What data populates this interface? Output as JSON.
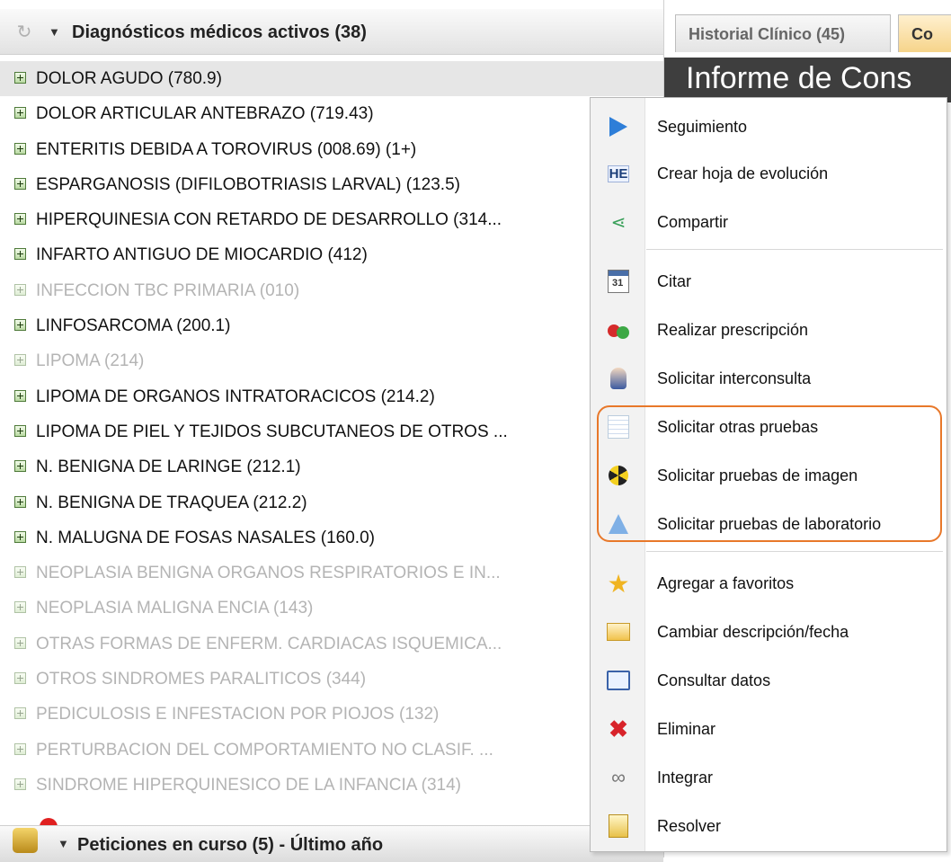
{
  "left_panel": {
    "header_title": "Diagnósticos médicos activos  (38)",
    "diagnoses": [
      {
        "label": "DOLOR AGUDO (780.9)",
        "active": true,
        "selected": true
      },
      {
        "label": "DOLOR ARTICULAR ANTEBRAZO (719.43)",
        "active": true
      },
      {
        "label": "ENTERITIS DEBIDA A TOROVIRUS (008.69) (1+)",
        "active": true
      },
      {
        "label": "ESPARGANOSIS (DIFILOBOTRIASIS LARVAL) (123.5)",
        "active": true
      },
      {
        "label": "HIPERQUINESIA CON RETARDO DE DESARROLLO (314...",
        "active": true
      },
      {
        "label": "INFARTO ANTIGUO DE MIOCARDIO (412)",
        "active": true
      },
      {
        "label": "INFECCION TBC PRIMARIA (010)",
        "active": false
      },
      {
        "label": "LINFOSARCOMA (200.1)",
        "active": true
      },
      {
        "label": "LIPOMA (214)",
        "active": false
      },
      {
        "label": "LIPOMA DE ORGANOS INTRATORACICOS (214.2)",
        "active": true
      },
      {
        "label": "LIPOMA DE PIEL Y TEJIDOS SUBCUTANEOS DE OTROS ...",
        "active": true
      },
      {
        "label": "N. BENIGNA DE LARINGE (212.1)",
        "active": true
      },
      {
        "label": "N. BENIGNA DE TRAQUEA (212.2)",
        "active": true
      },
      {
        "label": "N. MALUGNA DE FOSAS NASALES (160.0)",
        "active": true
      },
      {
        "label": "NEOPLASIA BENIGNA ORGANOS RESPIRATORIOS E IN...",
        "active": false
      },
      {
        "label": "NEOPLASIA MALIGNA ENCIA (143)",
        "active": false
      },
      {
        "label": "OTRAS FORMAS DE ENFERM. CARDIACAS ISQUEMICA...",
        "active": false
      },
      {
        "label": "OTROS SINDROMES PARALITICOS (344)",
        "active": false
      },
      {
        "label": "PEDICULOSIS E INFESTACION POR PIOJOS (132)",
        "active": false
      },
      {
        "label": "PERTURBACION DEL COMPORTAMIENTO NO CLASIF. ...",
        "active": false
      },
      {
        "label": "SINDROME HIPERQUINESICO DE LA INFANCIA (314)",
        "active": false
      }
    ],
    "bottom_header_title": "Peticiones en curso (5) - Último año"
  },
  "right_panel": {
    "tabs": [
      "Historial Clínico (45)",
      "Co"
    ],
    "document_title": "Informe de Cons"
  },
  "context_menu": {
    "items": [
      {
        "label": "Seguimiento",
        "icon": "arrow-right-icon"
      },
      {
        "label": "Crear hoja de evolución",
        "icon": "he-icon"
      },
      {
        "label": "Compartir",
        "icon": "share-icon"
      },
      {
        "label": "Citar",
        "icon": "calendar-icon"
      },
      {
        "label": "Realizar prescripción",
        "icon": "pills-icon"
      },
      {
        "label": "Solicitar interconsulta",
        "icon": "doctor-icon"
      },
      {
        "label": "Solicitar otras pruebas",
        "icon": "document-lines-icon"
      },
      {
        "label": "Solicitar pruebas de imagen",
        "icon": "radiation-icon"
      },
      {
        "label": "Solicitar pruebas de laboratorio",
        "icon": "flask-icon"
      },
      {
        "label": "Agregar a favoritos",
        "icon": "star-icon"
      },
      {
        "label": "Cambiar descripción/fecha",
        "icon": "envelope-icon"
      },
      {
        "label": "Consultar datos",
        "icon": "book-icon"
      },
      {
        "label": "Eliminar",
        "icon": "delete-x-icon"
      },
      {
        "label": "Integrar",
        "icon": "link-icon"
      },
      {
        "label": "Resolver",
        "icon": "folder-icon"
      }
    ]
  },
  "colors": {
    "highlight_box": "#e8782a",
    "inactive_text": "#b4b4b4"
  }
}
